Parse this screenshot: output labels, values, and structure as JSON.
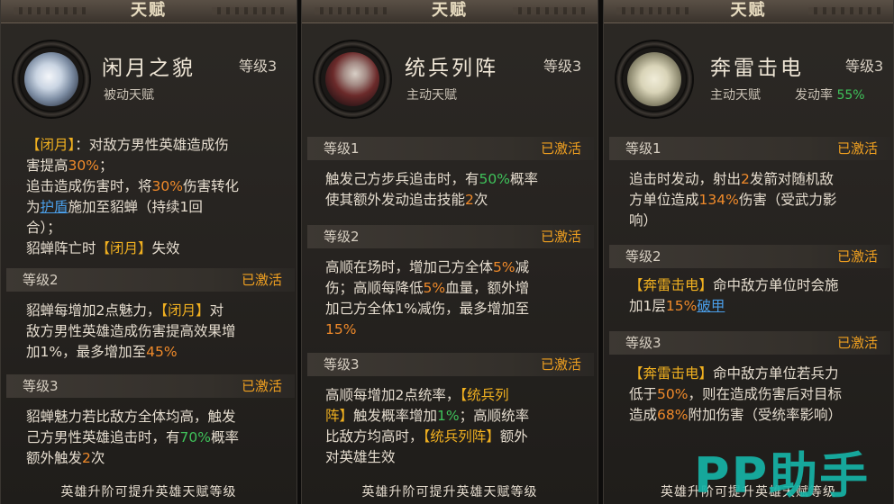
{
  "panels": [
    {
      "title": "天赋",
      "name": "闲月之貌",
      "level": "等级3",
      "type": "被动天赋",
      "intro": [
        [
          {
            "t": "【闭月】",
            "c": "yellow"
          },
          {
            "t": "：对敌方男性英雄造成伤"
          }
        ],
        [
          {
            "t": "害提高"
          },
          {
            "t": "30%",
            "c": "orange"
          },
          {
            "t": "；"
          }
        ],
        [
          {
            "t": "追击造成伤害时，将"
          },
          {
            "t": "30%",
            "c": "orange"
          },
          {
            "t": "伤害转化"
          }
        ],
        [
          {
            "t": "为"
          },
          {
            "t": "护盾",
            "c": "blue"
          },
          {
            "t": "施加至貂蝉（持续1回"
          }
        ],
        [
          {
            "t": "合）；"
          }
        ],
        [
          {
            "t": "貂蝉阵亡时"
          },
          {
            "t": "【闭月】",
            "c": "yellow"
          },
          {
            "t": "失效"
          }
        ]
      ],
      "levels": [
        {
          "label": "等级2",
          "status": "已激活",
          "lines": [
            [
              {
                "t": "貂蝉每增加2点魅力，"
              },
              {
                "t": "【闭月】",
                "c": "yellow"
              },
              {
                "t": "对"
              }
            ],
            [
              {
                "t": "敌方男性英雄造成伤害提高效果增"
              }
            ],
            [
              {
                "t": "加1%，最多增加至"
              },
              {
                "t": "45%",
                "c": "orange"
              }
            ]
          ]
        },
        {
          "label": "等级3",
          "status": "已激活",
          "lines": [
            [
              {
                "t": "貂蝉魅力若比敌方全体均高，触发"
              }
            ],
            [
              {
                "t": "己方男性英雄追击时，有"
              },
              {
                "t": "70%",
                "c": "green"
              },
              {
                "t": "概率"
              }
            ],
            [
              {
                "t": "额外触发"
              },
              {
                "t": "2",
                "c": "orange"
              },
              {
                "t": "次"
              }
            ]
          ]
        }
      ],
      "footer": "英雄升阶可提升英雄天赋等级"
    },
    {
      "title": "天赋",
      "name": "统兵列阵",
      "level": "等级3",
      "type": "主动天赋",
      "levels": [
        {
          "label": "等级1",
          "status": "已激活",
          "lines": [
            [
              {
                "t": "触发己方步兵追击时，有"
              },
              {
                "t": "50%",
                "c": "green"
              },
              {
                "t": "概率"
              }
            ],
            [
              {
                "t": "使其额外发动追击技能"
              },
              {
                "t": "2",
                "c": "orange"
              },
              {
                "t": "次"
              }
            ]
          ]
        },
        {
          "label": "等级2",
          "status": "已激活",
          "lines": [
            [
              {
                "t": "高顺在场时，增加己方全体"
              },
              {
                "t": "5%",
                "c": "orange"
              },
              {
                "t": "减"
              }
            ],
            [
              {
                "t": "伤；高顺每降低"
              },
              {
                "t": "5%",
                "c": "orange"
              },
              {
                "t": "血量，额外增"
              }
            ],
            [
              {
                "t": "加己方全体1%减伤，最多增加至"
              }
            ],
            [
              {
                "t": "15%",
                "c": "orange"
              }
            ]
          ]
        },
        {
          "label": "等级3",
          "status": "已激活",
          "lines": [
            [
              {
                "t": "高顺每增加2点统率，"
              },
              {
                "t": "【统兵列",
                "c": "yellow"
              }
            ],
            [
              {
                "t": "阵】",
                "c": "yellow"
              },
              {
                "t": "触发概率增加"
              },
              {
                "t": "1%",
                "c": "green"
              },
              {
                "t": "；高顺统率"
              }
            ],
            [
              {
                "t": "比敌方均高时，"
              },
              {
                "t": "【统兵列阵】",
                "c": "yellow"
              },
              {
                "t": "额外"
              }
            ],
            [
              {
                "t": "对英雄生效"
              }
            ]
          ]
        }
      ],
      "footer": "英雄升阶可提升英雄天赋等级"
    },
    {
      "title": "天赋",
      "name": "奔雷击电",
      "level": "等级3",
      "type": "主动天赋",
      "rate_label": "发动率",
      "rate_value": "55%",
      "levels": [
        {
          "label": "等级1",
          "status": "已激活",
          "lines": [
            [
              {
                "t": "追击时发动，射出"
              },
              {
                "t": "2",
                "c": "orange"
              },
              {
                "t": "发箭对随机敌"
              }
            ],
            [
              {
                "t": "方单位造成"
              },
              {
                "t": "134%",
                "c": "orange"
              },
              {
                "t": "伤害（受武力影"
              }
            ],
            [
              {
                "t": "响）"
              }
            ]
          ]
        },
        {
          "label": "等级2",
          "status": "已激活",
          "lines": [
            [
              {
                "t": "【奔雷击电】",
                "c": "yellow"
              },
              {
                "t": "命中敌方单位时会施"
              }
            ],
            [
              {
                "t": "加1层"
              },
              {
                "t": "15%",
                "c": "orange"
              },
              {
                "t": "破甲",
                "c": "blue"
              }
            ]
          ]
        },
        {
          "label": "等级3",
          "status": "已激活",
          "lines": [
            [
              {
                "t": "【奔雷击电】",
                "c": "yellow"
              },
              {
                "t": "命中敌方单位若兵力"
              }
            ],
            [
              {
                "t": "低于"
              },
              {
                "t": "50%",
                "c": "orange"
              },
              {
                "t": "，则在造成伤害后对目标"
              }
            ],
            [
              {
                "t": "造成"
              },
              {
                "t": "68%",
                "c": "orange"
              },
              {
                "t": "附加伤害（受统率影响）"
              }
            ]
          ]
        }
      ],
      "footer": "英雄升阶可提升英雄天赋等级"
    }
  ],
  "watermark": "PP助手"
}
